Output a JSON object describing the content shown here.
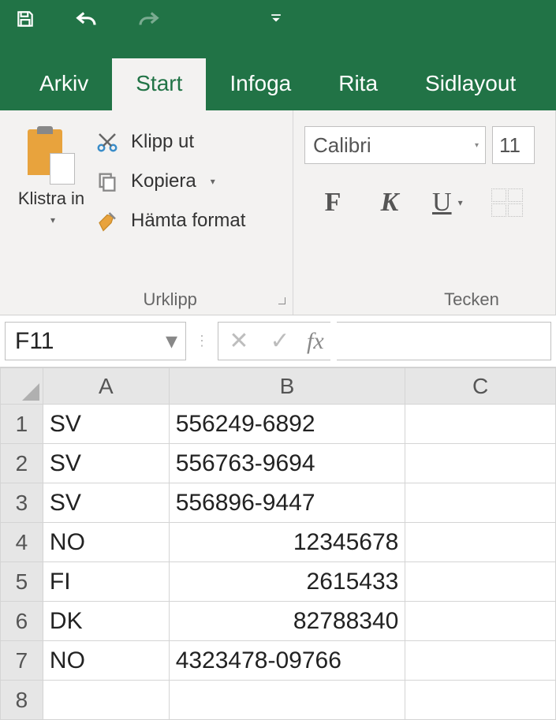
{
  "qat": {
    "save": "save-icon",
    "undo": "undo-icon",
    "redo": "redo-icon"
  },
  "tabs": {
    "arkiv": "Arkiv",
    "start": "Start",
    "infoga": "Infoga",
    "rita": "Rita",
    "sidlayout": "Sidlayout"
  },
  "clipboard": {
    "paste_label": "Klistra in",
    "cut_label": "Klipp ut",
    "copy_label": "Kopiera",
    "format_painter_label": "Hämta format",
    "group_label": "Urklipp"
  },
  "font": {
    "name": "Calibri",
    "size": "11",
    "bold": "F",
    "italic": "K",
    "underline": "U",
    "group_label": "Tecken"
  },
  "namebox": {
    "value": "F11"
  },
  "formula_bar": {
    "cancel": "✕",
    "confirm": "✓",
    "fx": "fx",
    "value": ""
  },
  "columns": [
    "A",
    "B",
    "C"
  ],
  "rows": [
    {
      "n": "1",
      "A": "SV",
      "B": "556249-6892",
      "B_align": "l"
    },
    {
      "n": "2",
      "A": "SV",
      "B": "556763-9694",
      "B_align": "l"
    },
    {
      "n": "3",
      "A": "SV",
      "B": "556896-9447",
      "B_align": "l"
    },
    {
      "n": "4",
      "A": "NO",
      "B": "12345678",
      "B_align": "r"
    },
    {
      "n": "5",
      "A": "FI",
      "B": "2615433",
      "B_align": "r"
    },
    {
      "n": "6",
      "A": "DK",
      "B": "82788340",
      "B_align": "r"
    },
    {
      "n": "7",
      "A": "NO",
      "B": "4323478-09766",
      "B_align": "l"
    },
    {
      "n": "8",
      "A": "",
      "B": "",
      "B_align": "l"
    }
  ]
}
